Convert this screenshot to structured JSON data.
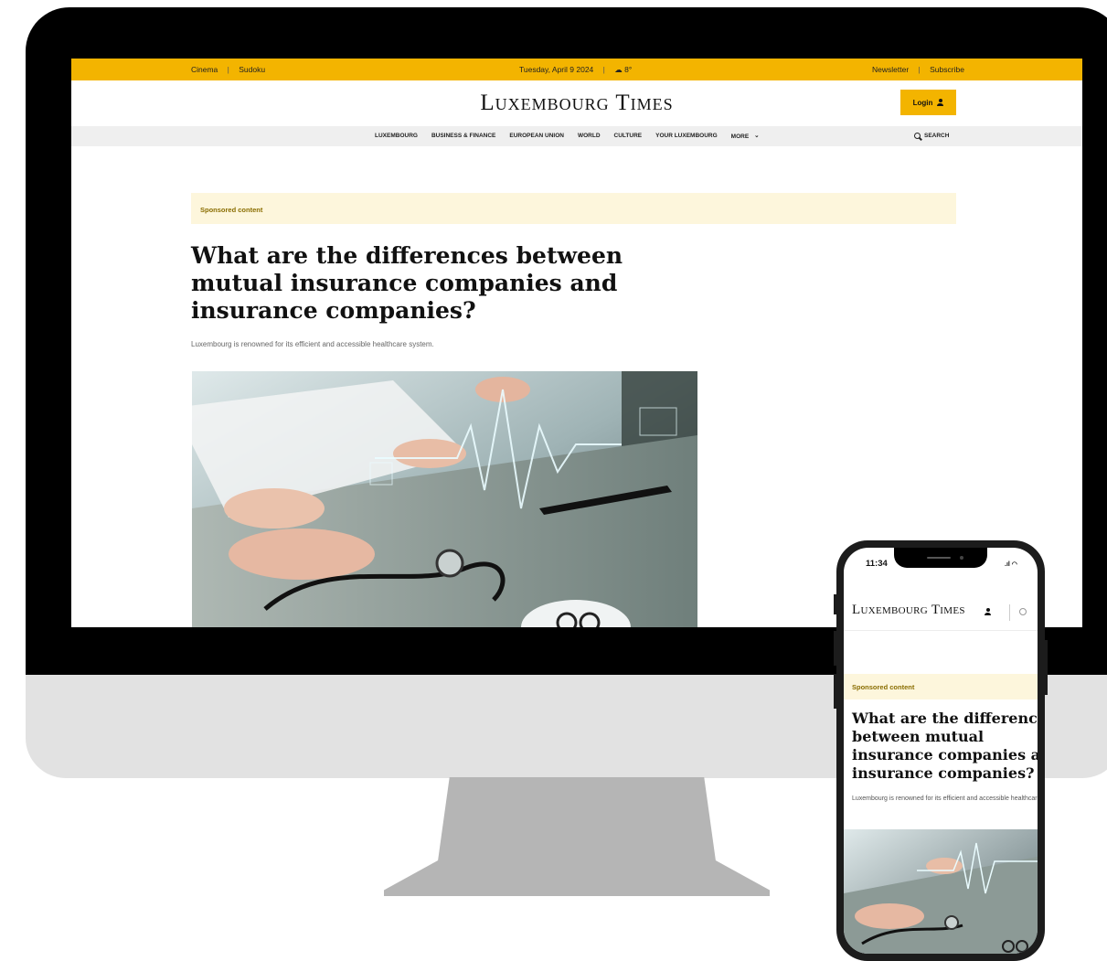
{
  "desktop": {
    "topbar": {
      "left_items": [
        "Cinema",
        "Sudoku"
      ],
      "date": "Tuesday, April 9 2024",
      "weather": "8°",
      "right_items": [
        "Newsletter",
        "Subscribe"
      ],
      "color": "#f3b400"
    },
    "masthead": {
      "logo": "Luxembourg Times",
      "login_label": "Login"
    },
    "nav": {
      "items": [
        "LUXEMBOURG",
        "BUSINESS & FINANCE",
        "EUROPEAN UNION",
        "WORLD",
        "CULTURE",
        "YOUR LUXEMBOURG",
        "MORE"
      ],
      "search_label": "SEARCH"
    },
    "article": {
      "sponsored_label": "Sponsored content",
      "headline": "What are the differences between mutual insurance companies and insurance companies?",
      "subtitle": "Luxembourg is renowned for its efficient and accessible healthcare system."
    }
  },
  "mobile": {
    "time": "11:34",
    "logo": "Luxembourg Times",
    "sponsored_label": "Sponsored content",
    "headline_lines": [
      "What are the differenc",
      "between mutual",
      "insurance companies a",
      "insurance companies?"
    ],
    "subtitle": "Luxembourg is renowned for its efficient and accessible healthcare system."
  }
}
